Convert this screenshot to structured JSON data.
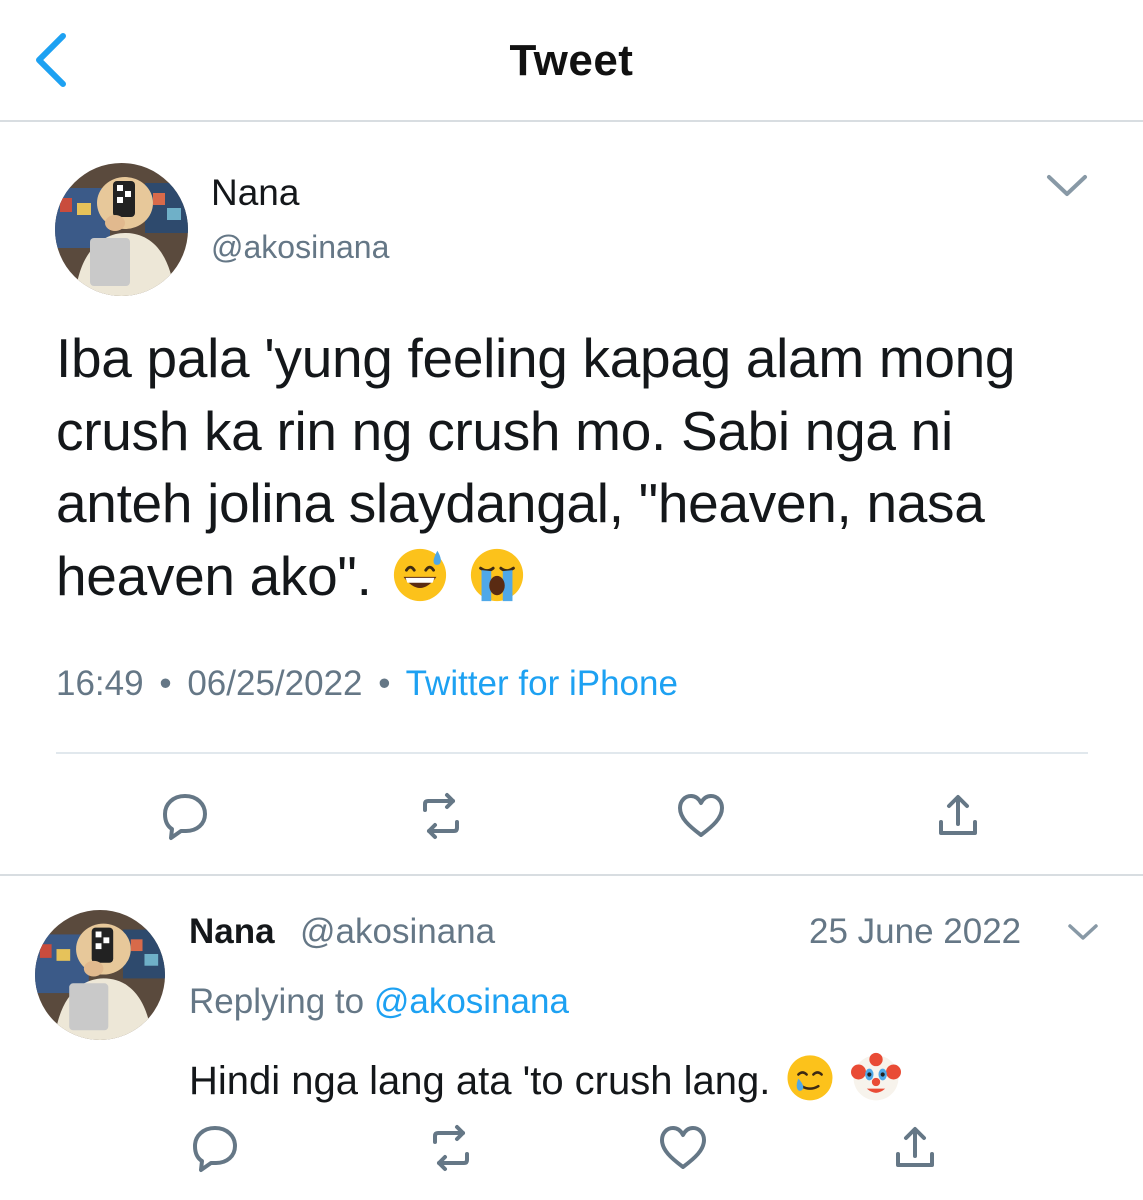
{
  "header": {
    "title": "Tweet",
    "back_icon": "chevron-left-icon",
    "accent_color": "#1da1f2"
  },
  "tweet": {
    "author_name": "Nana",
    "author_handle": "@akosinana",
    "text": "Iba pala 'yung feeling kapag alam mong crush ka rin ng crush mo. Sabi nga ni anteh jolina slaydangal, \"heaven, nasa heaven ako\".",
    "emojis": [
      "grinning-sweat-emoji",
      "loudly-crying-emoji"
    ],
    "time": "16:49",
    "date": "06/25/2022",
    "separator": "•",
    "source": "Twitter for iPhone",
    "actions": [
      "reply-icon",
      "retweet-icon",
      "like-icon",
      "share-icon"
    ]
  },
  "reply": {
    "author_name": "Nana",
    "author_handle": "@akosinana",
    "date": "25 June 2022",
    "replying_label": "Replying to",
    "replying_to": "@akosinana",
    "text": "Hindi nga lang ata 'to crush lang.",
    "emojis": [
      "smiling-with-tear-emoji",
      "clown-face-emoji"
    ],
    "actions": [
      "reply-icon",
      "retweet-icon",
      "like-icon",
      "share-icon"
    ]
  },
  "colors": {
    "text_primary": "#14171a",
    "text_secondary": "#657786",
    "link": "#1da1f2",
    "icon": "#657786",
    "divider": "#e1e8ed"
  }
}
